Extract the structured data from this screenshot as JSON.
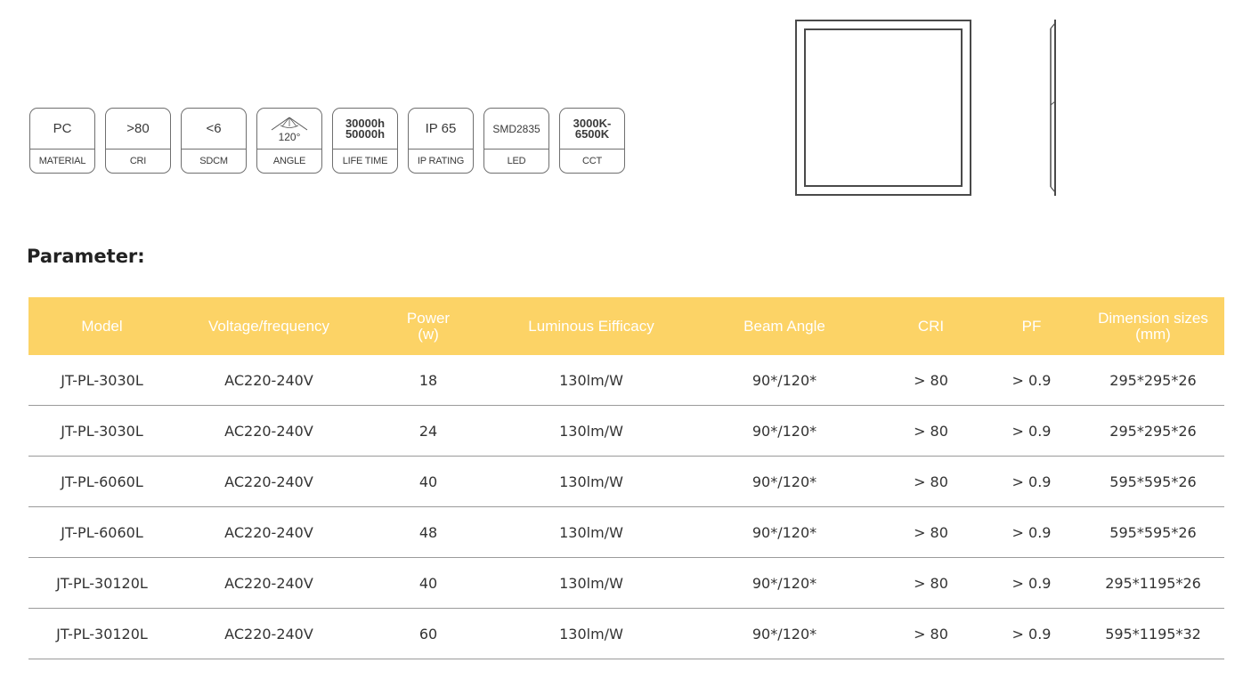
{
  "badges": [
    {
      "value": "PC",
      "label": "MATERIAL"
    },
    {
      "value": ">80",
      "label": "CRI"
    },
    {
      "value": "<6",
      "label": "SDCM"
    },
    {
      "value": "120°",
      "label": "ANGLE"
    },
    {
      "value_line1": "30000h",
      "value_line2": "50000h",
      "label": "LIFE TIME"
    },
    {
      "value": "IP 65",
      "label": "IP RATING"
    },
    {
      "value": "SMD2835",
      "label": "LED"
    },
    {
      "value_line1": "3000K-",
      "value_line2": "6500K",
      "label": "CCT"
    }
  ],
  "section_title": "Parameter:",
  "table": {
    "headers": [
      "Model",
      "Voltage/frequency",
      "Power",
      "(w)",
      "Luminous Eifficacy",
      "Beam Angle",
      "CRI",
      "PF",
      "Dimension sizes",
      "(mm)"
    ],
    "rows": [
      {
        "model": "JT-PL-3030L",
        "voltage": "AC220-240V",
        "power": "18",
        "efficacy": "130lm/W",
        "beam": "90*/120*",
        "cri": "> 80",
        "pf": "> 0.9",
        "dimension": "295*295*26"
      },
      {
        "model": "JT-PL-3030L",
        "voltage": "AC220-240V",
        "power": "24",
        "efficacy": "130lm/W",
        "beam": "90*/120*",
        "cri": "> 80",
        "pf": "> 0.9",
        "dimension": "295*295*26"
      },
      {
        "model": "JT-PL-6060L",
        "voltage": "AC220-240V",
        "power": "40",
        "efficacy": "130lm/W",
        "beam": "90*/120*",
        "cri": "> 80",
        "pf": "> 0.9",
        "dimension": "595*595*26"
      },
      {
        "model": "JT-PL-6060L",
        "voltage": "AC220-240V",
        "power": "48",
        "efficacy": "130lm/W",
        "beam": "90*/120*",
        "cri": "> 80",
        "pf": "> 0.9",
        "dimension": "595*595*26"
      },
      {
        "model": "JT-PL-30120L",
        "voltage": "AC220-240V",
        "power": "40",
        "efficacy": "130lm/W",
        "beam": "90*/120*",
        "cri": "> 80",
        "pf": "> 0.9",
        "dimension": "295*1195*26"
      },
      {
        "model": "JT-PL-30120L",
        "voltage": "AC220-240V",
        "power": "60",
        "efficacy": "130lm/W",
        "beam": "90*/120*",
        "cri": "> 80",
        "pf": "> 0.9",
        "dimension": "595*1195*32"
      }
    ]
  },
  "colors": {
    "header_bg": "#fcd366",
    "header_text": "#ffffff",
    "border": "#9a9a9a"
  }
}
